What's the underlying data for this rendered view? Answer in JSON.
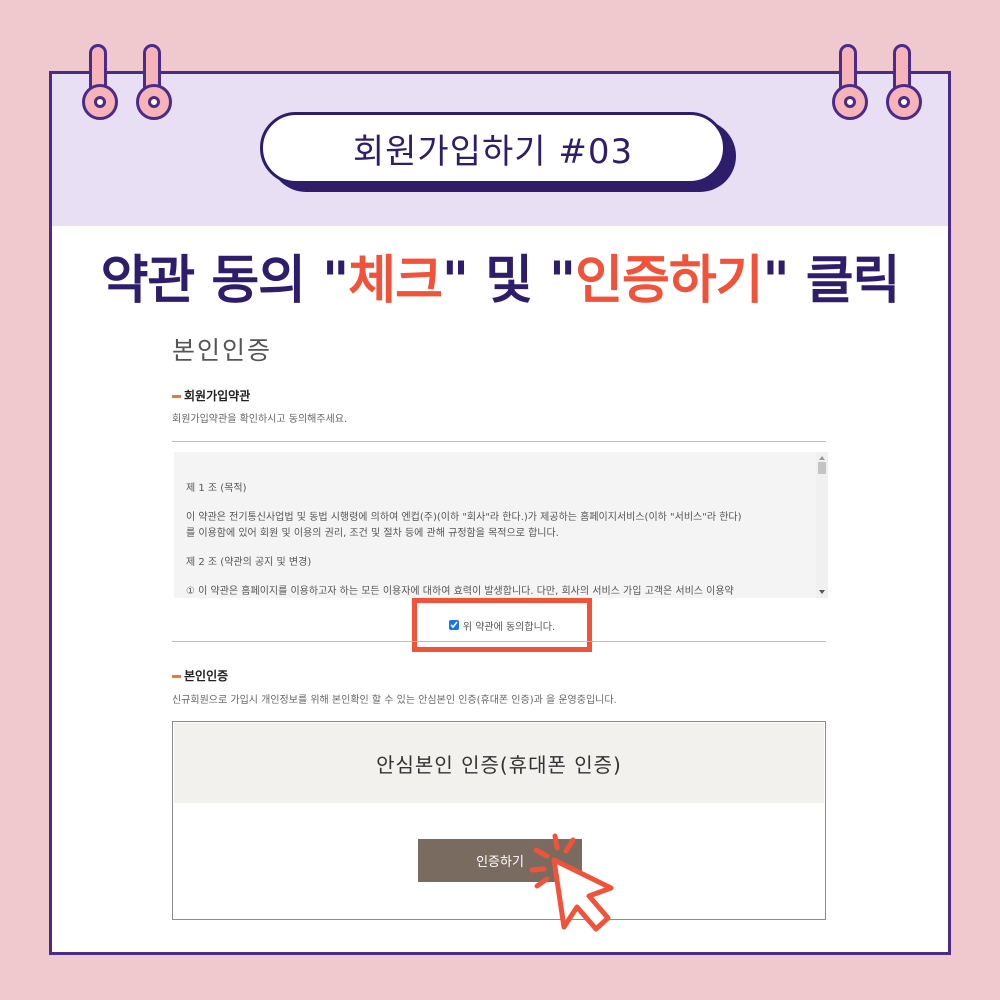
{
  "banner": {
    "title": "회원가입하기 #03"
  },
  "headline": {
    "part1": "약관 동의 \"",
    "highlight1": "체크",
    "part2": "\" 및 \"",
    "highlight2": "인증하기",
    "part3": "\" 클릭"
  },
  "page": {
    "title": "본인인증"
  },
  "terms_section": {
    "title": "회원가입약관",
    "description": "회원가입약관을 확인하시고 동의해주세요.",
    "lines": [
      "제 1 조 (목적)",
      "이 약관은 전기통신사업법 및 동법 시행령에 의하여 엔컵(주)(이하 \"회사\"라 한다.)가 제공하는 홈페이지서비스(이하 \"서비스\"라 한다)",
      "를 이용함에 있어 회원 및 이용의 권리, 조건 및 절차 등에 관해 규정함을 목적으로 합니다.",
      "제 2 조 (약관의 공지 및 변경)",
      "① 이 약관은 홈페이지를 이용하고자 하는 모든 이용자에 대하여 효력이 발생합니다. 다만, 회사의 서비스 가입 고객은 서비스 이용약"
    ],
    "agree_label": "위 약관에 동의합니다.",
    "agree_checked": true
  },
  "auth_section": {
    "title": "본인인증",
    "description": "신규회원으로 가입시 개인정보를 위해 본인확인 할 수 있는 안심본인 인증(휴대폰 인증)과 을 운영중입니다.",
    "box_title": "안심본인 인증(휴대폰 인증)",
    "button_label": "인증하기"
  },
  "colors": {
    "background": "#f0c9cf",
    "frame": "#4a2b8c",
    "banner": "#e8dff5",
    "navy": "#2e1d6a",
    "highlight": "#f0533a",
    "button": "#7a6b61"
  }
}
